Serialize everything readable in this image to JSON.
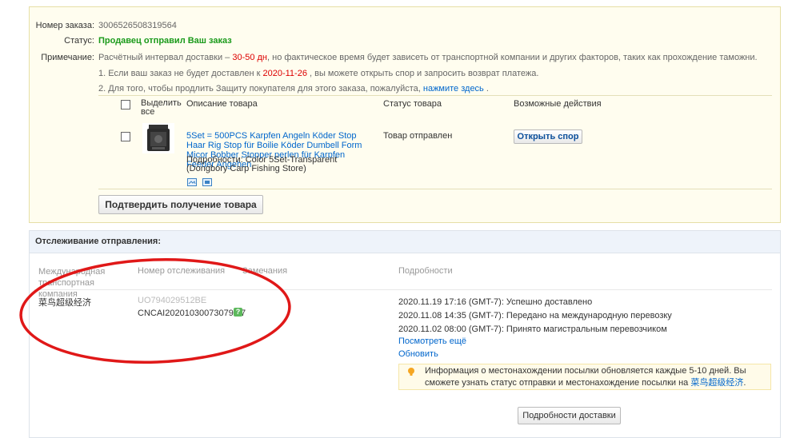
{
  "order": {
    "number_label": "Номер заказа:",
    "number_value": "3006526508319564",
    "status_label": "Статус:",
    "status_value": "Продавец отправил Ваш заказ",
    "note_label": "Примечание:",
    "note_part1": "Расчётный интервал доставки –",
    "note_days": "30-50 дн",
    "note_part2": ", но фактическое время будет зависеть от транспортной компании и других факторов, таких как прохождение таможни.",
    "item1_part1": "1. Если ваш заказ не будет доставлен к",
    "item1_date": "2020-11-26",
    "item1_part2": ", вы можете открыть спор и запросить возврат платежа.",
    "item2_part1": "2. Для того, чтобы продлить Защиту покупателя для этого заказа, пожалуйста,",
    "item2_link": "нажмите здесь",
    "item2_part2": "."
  },
  "table": {
    "select_all": "Выделить все",
    "col_description": "Описание товара",
    "col_status": "Статус товара",
    "col_actions": "Возможные действия"
  },
  "product": {
    "title": "5Set = 500PCS Karpfen Angeln Köder Stop Haar Rig Stop für Boilie Köder Dumbell Form Micor Bobber Stopper perlen für Karpfen Feeder Angehen",
    "details": "Подробности: Color 5Set-Transparent",
    "store": "(Dongbory Carp Fishing Store)",
    "status": "Товар отправлен",
    "dispute_button": "Открыть спор"
  },
  "confirm_button": "Подтвердить получение товара",
  "tracking": {
    "header": "Отслеживание отправления:",
    "col_company": "Международная транспортная компания",
    "col_number": "Номер отслеживания",
    "col_remarks": "Замечания",
    "col_details": "Подробности",
    "company": "菜鸟超级经济",
    "number_primary": "UO794029512BE",
    "number_secondary": "CNCAI202010300730791 7",
    "events": [
      "2020.11.19 17:16 (GMT-7): Успешно доставлено",
      "2020.11.08 14:35 (GMT-7): Передано на международную перевозку",
      "2020.11.02 08:00 (GMT-7): Принято магистральным перевозчиком"
    ],
    "see_more": "Посмотреть ещё",
    "refresh": "Обновить",
    "info_part1": "Информация о местонахождении посылки обновляется каждые 5-10 дней. Вы сможете узнать статус отправки и местонахождение посылки на",
    "info_link": "菜鸟超级经济",
    "info_part2": ".",
    "delivery_details_button": "Подробности доставки"
  }
}
